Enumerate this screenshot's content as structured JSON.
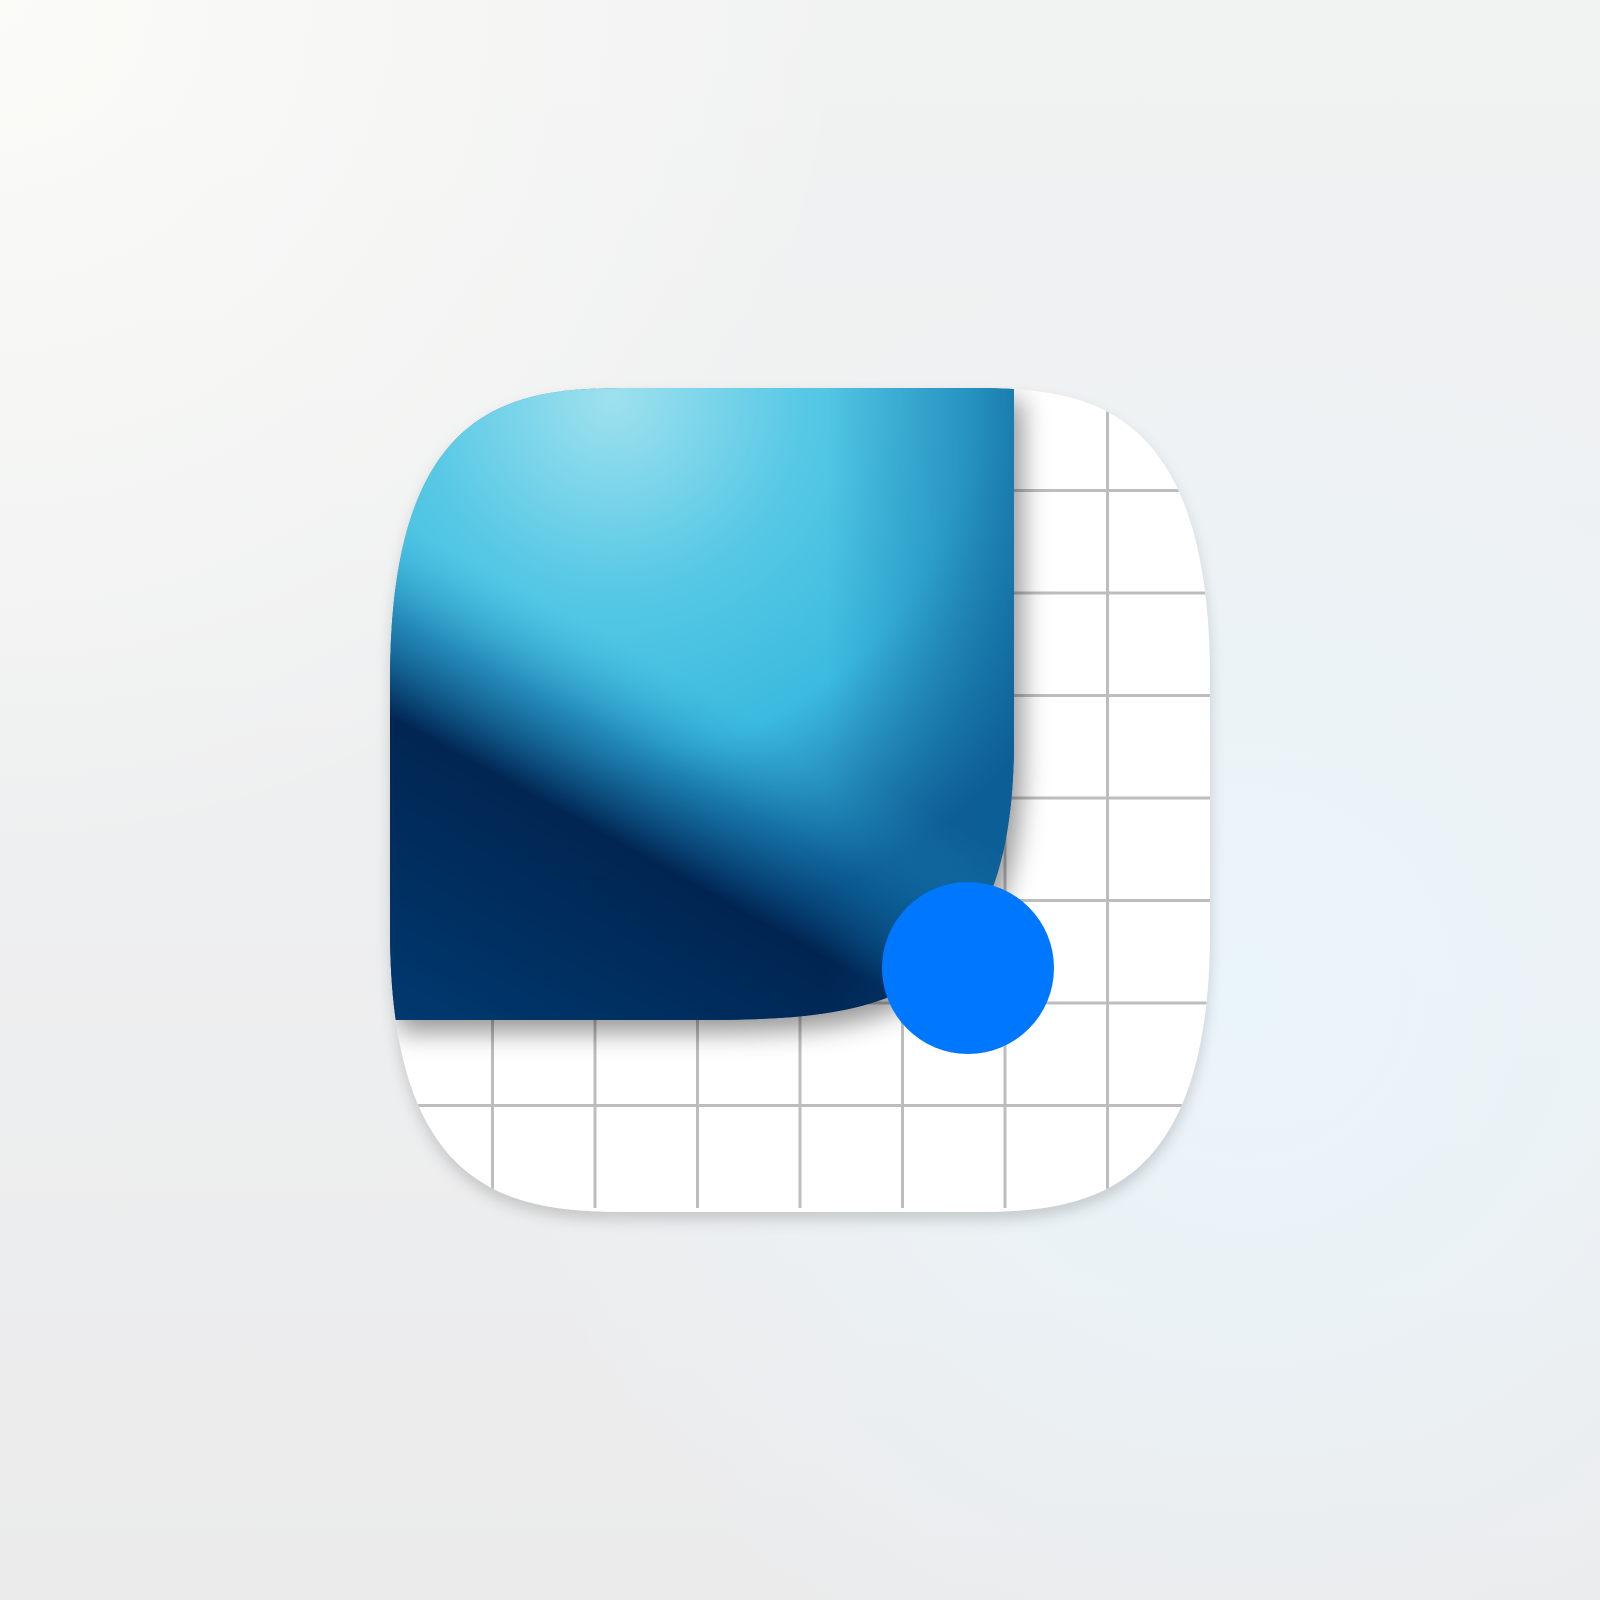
{
  "app_icon": {
    "name": "blueprint-canvas-app-icon",
    "colors": {
      "tile": "#ffffff",
      "grid_line": "#bdbdbd",
      "gradient_light": "#9fe1ee",
      "gradient_mid": "#3bbadf",
      "gradient_deep": "#0f5f97",
      "gradient_dark": "#002350",
      "dot": "#0077ff"
    },
    "grid": {
      "columns": 8,
      "rows": 8
    }
  }
}
